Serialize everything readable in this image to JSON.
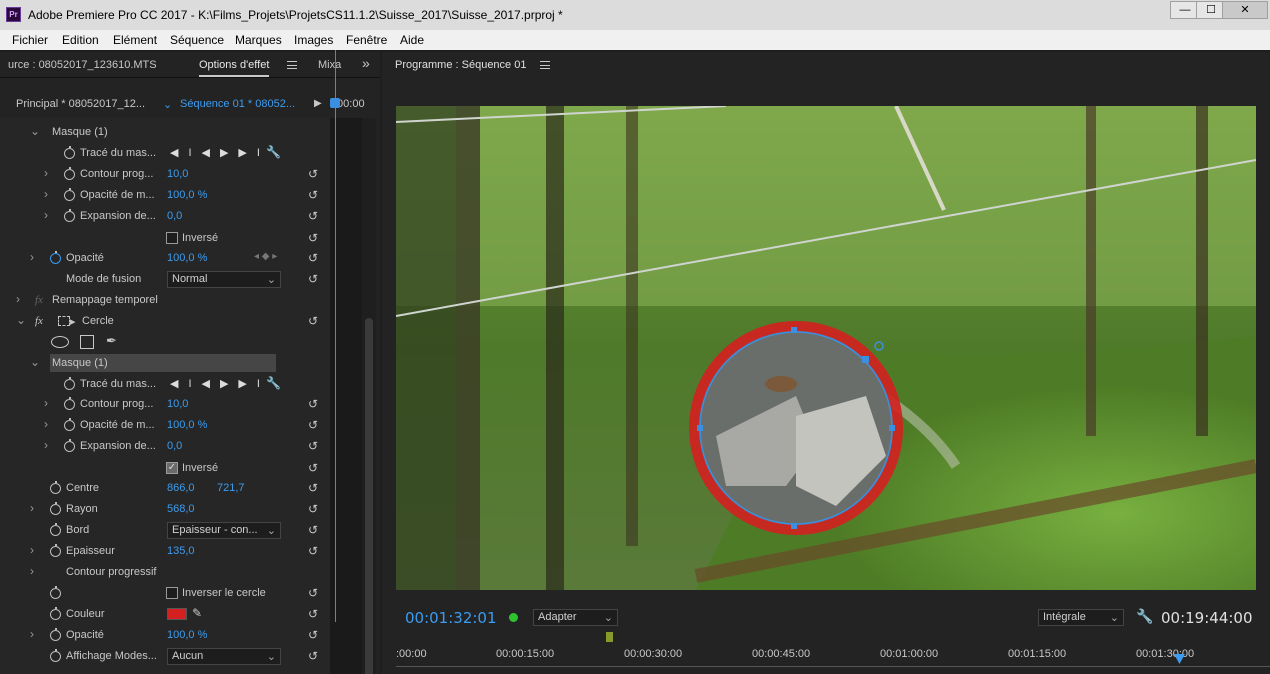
{
  "window": {
    "app_icon": "Pr",
    "title": "Adobe Premiere Pro CC 2017 - K:\\Films_Projets\\ProjetsCS11.1.2\\Suisse_2017\\Suisse_2017.prproj *",
    "minimize": "—",
    "maximize": "☐",
    "close": "✕"
  },
  "menu": [
    "Fichier",
    "Edition",
    "Elément",
    "Séquence",
    "Marques",
    "Images",
    "Fenêtre",
    "Aide"
  ],
  "left_tabs": {
    "source": "urce : 08052017_123610.MTS",
    "effect_options": "Options d'effet",
    "mixer": "Mixa",
    "overflow": "»"
  },
  "sequence_row": {
    "principal": "Principal * 08052017_12...",
    "sequence": "Séquence 01 * 08052...",
    "play": "▶",
    "time": ":00:00"
  },
  "effect_rows": [
    {
      "label": "Masque (1)"
    },
    {
      "label": "Tracé du mas..."
    },
    {
      "label": "Contour prog...",
      "value": "10,0"
    },
    {
      "label": "Opacité de m...",
      "value": "100,0 %"
    },
    {
      "label": "Expansion de...",
      "value": "0,0"
    },
    {
      "label": "Inversé",
      "checked": false
    },
    {
      "label": "Opacité",
      "value": "100,0 %"
    },
    {
      "label": "Mode de fusion",
      "value": "Normal"
    },
    {
      "label": "Remappage temporel",
      "fx": "fx"
    },
    {
      "label": "Cercle",
      "fx": "fx"
    },
    {
      "label": "Masque (1)"
    },
    {
      "label": "Tracé du mas..."
    },
    {
      "label": "Contour prog...",
      "value": "10,0"
    },
    {
      "label": "Opacité de m...",
      "value": "100,0 %"
    },
    {
      "label": "Expansion de...",
      "value": "0,0"
    },
    {
      "label": "Inversé",
      "checked": true
    },
    {
      "label": "Centre",
      "value": "866,0",
      "value2": "721,7"
    },
    {
      "label": "Rayon",
      "value": "568,0"
    },
    {
      "label": "Bord",
      "value": "Epaisseur - con..."
    },
    {
      "label": "Epaisseur",
      "value": "135,0"
    },
    {
      "label": "Contour progressif"
    },
    {
      "label": "Inverser le cercle",
      "checked": false
    },
    {
      "label": "Couleur",
      "color": "#d42020"
    },
    {
      "label": "Opacité",
      "value": "100,0 %"
    },
    {
      "label": "Affichage Modes...",
      "value": "Aucun"
    }
  ],
  "program": {
    "title": "Programme : Séquence 01",
    "timecode_current": "00:01:32:01",
    "fit": "Adapter",
    "resolution": "Intégrale",
    "timecode_total": "00:19:44:00",
    "ruler": [
      ":00:00",
      "00:00:15:00",
      "00:00:30:00",
      "00:00:45:00",
      "00:01:00:00",
      "00:01:15:00",
      "00:01:30:00"
    ]
  },
  "colors": {
    "accent_blue": "#3b9cf0",
    "mask_red": "#d42020",
    "playhead": "#3b8fe0",
    "status_green": "#2ec32e"
  }
}
